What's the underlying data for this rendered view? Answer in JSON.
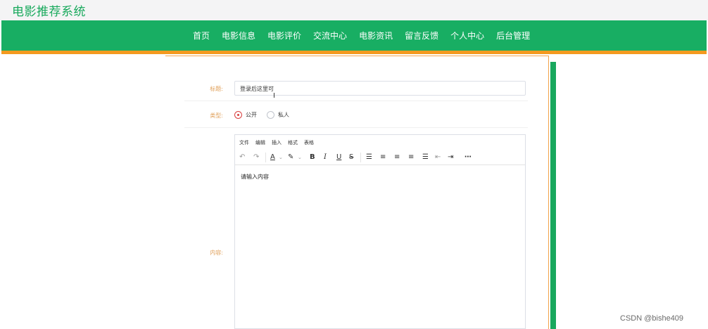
{
  "app": {
    "title": "电影推荐系统"
  },
  "nav": {
    "items": [
      "首页",
      "电影信息",
      "电影评价",
      "交流中心",
      "电影资讯",
      "留言反馈",
      "个人中心",
      "后台管理"
    ]
  },
  "form": {
    "title_label": "标题:",
    "title_value": "登录后这里可",
    "type_label": "类型:",
    "type_options": [
      "公开",
      "私人"
    ],
    "type_selected": "公开",
    "content_label": "内容:"
  },
  "editor": {
    "menus": [
      "文件",
      "编辑",
      "插入",
      "格式",
      "表格"
    ],
    "toolbar": {
      "undo": "↶",
      "redo": "↷",
      "font_color": "A",
      "highlight": "✎",
      "bold": "B",
      "italic": "I",
      "underline": "U",
      "strike": "S",
      "list": "☰",
      "more": "⋯"
    },
    "placeholder": "请输入内容"
  },
  "watermark": "CSDN @bishe409",
  "colors": {
    "brand_green": "#18ae63",
    "accent_orange": "#f39a1f",
    "radio_red": "#d94040"
  }
}
